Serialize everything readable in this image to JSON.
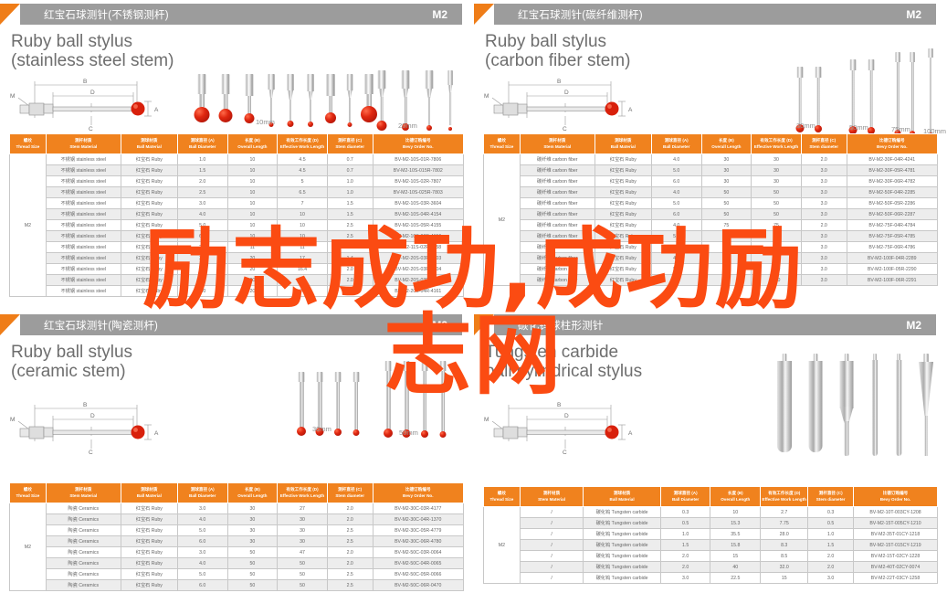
{
  "watermark": {
    "line1": "励志成功,成功励",
    "line2": "志网"
  },
  "table_headers": [
    {
      "cn": "螺纹",
      "en": "Thread Size"
    },
    {
      "cn": "测杆材质",
      "en": "Stem Material"
    },
    {
      "cn": "测球材质",
      "en": "Ball Material"
    },
    {
      "cn": "测球直径 (A)",
      "en": "Ball Diameter"
    },
    {
      "cn": "长度 (B)",
      "en": "Overall Length"
    },
    {
      "cn": "有效工作长度 (D)",
      "en": "Effective Work Length"
    },
    {
      "cn": "测杆直径 (C)",
      "en": "Stem diameter"
    },
    {
      "cn": "比德订购编号",
      "en": "Bevy Order No."
    }
  ],
  "diagram_labels": {
    "m": "M",
    "b": "B",
    "d": "D",
    "c": "C",
    "a": "A"
  },
  "panels": [
    {
      "header_title": "红宝石球测针(不锈钢测杆)",
      "header_code": "M2",
      "product_title_line1": "Ruby ball stylus",
      "product_title_line2": "(stainless steel stem)",
      "scale_labels": [
        "10mm",
        "20mm"
      ],
      "thread": "M2",
      "rows": [
        [
          "不锈钢 stainless steel",
          "红宝石 Ruby",
          "1.0",
          "10",
          "4.5",
          "0.7",
          "BV-M2-10S-01R-7806"
        ],
        [
          "不锈钢 stainless steel",
          "红宝石 Ruby",
          "1.5",
          "10",
          "4.5",
          "0.7",
          "BV-M2-10S-015R-7802"
        ],
        [
          "不锈钢 stainless steel",
          "红宝石 Ruby",
          "2.0",
          "10",
          "5",
          "1.0",
          "BV-M2-10S-02R-7807"
        ],
        [
          "不锈钢 stainless steel",
          "红宝石 Ruby",
          "2.5",
          "10",
          "6.5",
          "1.0",
          "BV-M2-10S-025R-7803"
        ],
        [
          "不锈钢 stainless steel",
          "红宝石 Ruby",
          "3.0",
          "10",
          "7",
          "1.5",
          "BV-M2-10S-03R-3604"
        ],
        [
          "不锈钢 stainless steel",
          "红宝石 Ruby",
          "4.0",
          "10",
          "10",
          "1.5",
          "BV-M2-10S-04R-4154"
        ],
        [
          "不锈钢 stainless steel",
          "红宝石 Ruby",
          "5.0",
          "10",
          "10",
          "2.5",
          "BV-M2-10S-05R-4155"
        ],
        [
          "不锈钢 stainless steel",
          "红宝石 Ruby",
          "6.0",
          "10",
          "10",
          "2.5",
          "BV-M2-10S-06R-4156"
        ],
        [
          "不锈钢 stainless steel",
          "红宝石 Ruby",
          "2.0",
          "11",
          "11",
          "2.5",
          "BV-M2-11S-02R-4158"
        ],
        [
          "不锈钢 stainless steel",
          "红宝石 Ruby",
          "3.0",
          "20",
          "17",
          "1.4",
          "BV-M2-20S-03R-3603"
        ],
        [
          "不锈钢 stainless steel",
          "红宝石 Ruby",
          "3.0",
          "20",
          "16.4",
          "2.0",
          "BV-M2-20S-03R-4104"
        ],
        [
          "不锈钢 stainless steel",
          "红宝石 Ruby",
          "3.0",
          "20",
          "17",
          "2.0",
          "BV-M2-20S-03R-4160"
        ],
        [
          "不锈钢 stainless steel",
          "红宝石 Ruby",
          "4.0",
          "20",
          "20",
          "2.0",
          "BV-M2-20S-04R-4161"
        ]
      ]
    },
    {
      "header_title": "红宝石球测针(碳纤维测杆)",
      "header_code": "M2",
      "product_title_line1": "Ruby ball stylus",
      "product_title_line2": "(carbon fiber stem)",
      "scale_labels": [
        "30mm",
        "50mm",
        "75mm",
        "100mm"
      ],
      "thread": "M2",
      "rows": [
        [
          "碳纤维 carbon fiber",
          "红宝石 Ruby",
          "4.0",
          "30",
          "30",
          "2.0",
          "BV-M2-30F-04R-4241"
        ],
        [
          "碳纤维 carbon fiber",
          "红宝石 Ruby",
          "5.0",
          "30",
          "30",
          "3.0",
          "BV-M2-30F-05R-4781"
        ],
        [
          "碳纤维 carbon fiber",
          "红宝石 Ruby",
          "6.0",
          "30",
          "30",
          "3.0",
          "BV-M2-30F-06R-4782"
        ],
        [
          "碳纤维 carbon fiber",
          "红宝石 Ruby",
          "4.0",
          "50",
          "50",
          "3.0",
          "BV-M2-50F-04R-2285"
        ],
        [
          "碳纤维 carbon fiber",
          "红宝石 Ruby",
          "5.0",
          "50",
          "50",
          "3.0",
          "BV-M2-50F-05R-2286"
        ],
        [
          "碳纤维 carbon fiber",
          "红宝石 Ruby",
          "6.0",
          "50",
          "50",
          "3.0",
          "BV-M2-50F-06R-2287"
        ],
        [
          "碳纤维 carbon fiber",
          "红宝石 Ruby",
          "4.0",
          "75",
          "75",
          "2.0",
          "BV-M2-75F-04R-4784"
        ],
        [
          "碳纤维 carbon fiber",
          "红宝石 Ruby",
          "5.0",
          "75",
          "75",
          "3.0",
          "BV-M2-75F-05R-4785"
        ],
        [
          "碳纤维 carbon fiber",
          "红宝石 Ruby",
          "6.0",
          "75",
          "75",
          "3.0",
          "BV-M2-75F-06R-4786"
        ],
        [
          "碳纤维 carbon fiber",
          "红宝石 Ruby",
          "4.0",
          "100",
          "100",
          "3.0",
          "BV-M2-100F-04R-2289"
        ],
        [
          "碳纤维 carbon fiber",
          "红宝石 Ruby",
          "5.0",
          "100",
          "100",
          "3.0",
          "BV-M2-100F-05R-2290"
        ],
        [
          "碳纤维 carbon fiber",
          "红宝石 Ruby",
          "6.0",
          "100",
          "100",
          "3.0",
          "BV-M2-100F-06R-2291"
        ]
      ]
    },
    {
      "header_title": "红宝石球测针(陶瓷测杆)",
      "header_code": "M2",
      "product_title_line1": "Ruby ball stylus",
      "product_title_line2": "(ceramic stem)",
      "scale_labels": [
        "30mm",
        "50mm"
      ],
      "thread": "M2",
      "rows": [
        [
          "陶瓷 Ceramics",
          "红宝石 Ruby",
          "3.0",
          "30",
          "27",
          "2.0",
          "BV-M2-30C-03R-4177"
        ],
        [
          "陶瓷 Ceramics",
          "红宝石 Ruby",
          "4.0",
          "30",
          "30",
          "2.0",
          "BV-M2-30C-04R-1370"
        ],
        [
          "陶瓷 Ceramics",
          "红宝石 Ruby",
          "5.0",
          "30",
          "30",
          "2.5",
          "BV-M2-30C-05R-4779"
        ],
        [
          "陶瓷 Ceramics",
          "红宝石 Ruby",
          "6.0",
          "30",
          "30",
          "2.5",
          "BV-M2-30C-06R-4780"
        ],
        [
          "陶瓷 Ceramics",
          "红宝石 Ruby",
          "3.0",
          "50",
          "47",
          "2.0",
          "BV-M2-50C-03R-0064"
        ],
        [
          "陶瓷 Ceramics",
          "红宝石 Ruby",
          "4.0",
          "50",
          "50",
          "2.0",
          "BV-M2-50C-04R-0065"
        ],
        [
          "陶瓷 Ceramics",
          "红宝石 Ruby",
          "5.0",
          "50",
          "50",
          "2.5",
          "BV-M2-50C-05R-0066"
        ],
        [
          "陶瓷 Ceramics",
          "红宝石 Ruby",
          "6.0",
          "50",
          "50",
          "2.5",
          "BV-M2-50C-06R-0470"
        ]
      ]
    },
    {
      "header_title": "碳化钨球柱形测针",
      "header_code": "M2",
      "product_title_line1": "Tungsten carbide",
      "product_title_line2": "ball cylindrical stylus",
      "scale_labels": [],
      "thread": "M2",
      "rows": [
        [
          "/",
          "碳化钨 Tungsten carbide",
          "0.3",
          "10",
          "2.7",
          "0.3",
          "BV-M2-10T-003CY-1208"
        ],
        [
          "/",
          "碳化钨 Tungsten carbide",
          "0.5",
          "15.3",
          "7.75",
          "0.5",
          "BV-M2-15T-005CY-1210"
        ],
        [
          "/",
          "碳化钨 Tungsten carbide",
          "1.0",
          "35.5",
          "28.0",
          "1.0",
          "BV-M2-35T-01CY-1218"
        ],
        [
          "/",
          "碳化钨 Tungsten carbide",
          "1.5",
          "15.8",
          "8.3",
          "1.5",
          "BV-M2-15T-015CY-1219"
        ],
        [
          "/",
          "碳化钨 Tungsten carbide",
          "2.0",
          "15",
          "8.5",
          "2.0",
          "BV-M2-15T-02CY-1228"
        ],
        [
          "/",
          "碳化钨 Tungsten carbide",
          "2.0",
          "40",
          "32.0",
          "2.0",
          "BV-M2-40T-02CY-0074"
        ],
        [
          "/",
          "碳化钨 Tungsten carbide",
          "3.0",
          "22.5",
          "15",
          "3.0",
          "BV-M2-22T-03CY-1258"
        ]
      ]
    }
  ]
}
